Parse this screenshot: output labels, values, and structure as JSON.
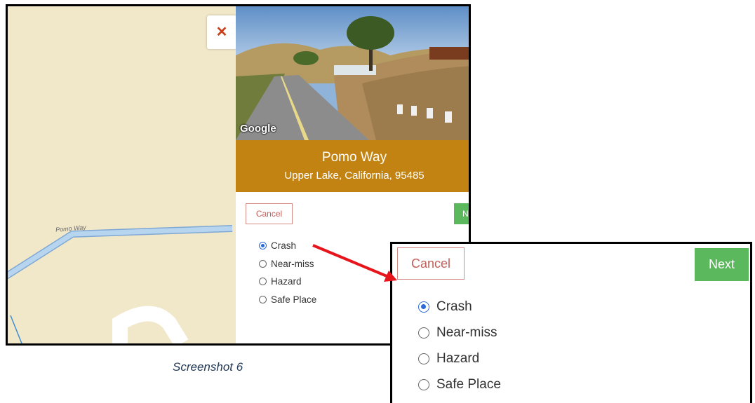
{
  "map": {
    "road_label": "Pomo Way",
    "close_symbol": "✕",
    "close_icon": "close-icon",
    "colors": {
      "land": "#f1e7c9",
      "road": "#a9c8e8",
      "accent_close": "#c8401a"
    }
  },
  "panel": {
    "streetview_credit": "Google",
    "location": {
      "street": "Pomo Way",
      "city_line": "Upper Lake, California, 95485",
      "banner_color": "#c38313"
    },
    "cancel_label": "Cancel",
    "next_label": "Next",
    "next_label_clipped": "N",
    "options": [
      {
        "label": "Crash",
        "selected": true
      },
      {
        "label": "Near-miss",
        "selected": false
      },
      {
        "label": "Hazard",
        "selected": false
      },
      {
        "label": "Safe Place",
        "selected": false
      }
    ]
  },
  "caption": "Screenshot 6",
  "zoom": {
    "cancel_label": "Cancel",
    "next_label": "Next",
    "options": [
      {
        "label": "Crash",
        "selected": true
      },
      {
        "label": "Near-miss",
        "selected": false
      },
      {
        "label": "Hazard",
        "selected": false
      },
      {
        "label": "Safe Place",
        "selected": false
      }
    ]
  },
  "colors": {
    "next_green": "#5cb85c",
    "cancel_border": "#d58b87",
    "radio_selected": "#2b6bd8",
    "arrow": "#e8141b"
  }
}
